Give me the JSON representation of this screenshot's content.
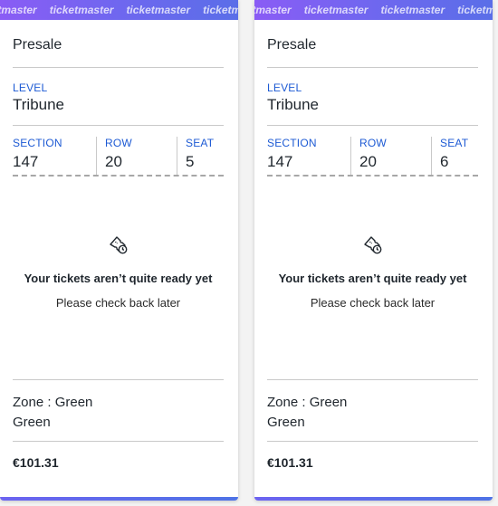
{
  "brand": "ticketmaster",
  "colors": {
    "accent": "#1d5ad4",
    "banner_start": "#8a5cf5",
    "banner_end": "#5a6ee8"
  },
  "labels": {
    "level": "LEVEL",
    "section": "SECTION",
    "row": "ROW",
    "seat": "SEAT"
  },
  "tickets": [
    {
      "type": "Presale",
      "level": "Tribune",
      "section": "147",
      "row": "20",
      "seat": "5",
      "status_icon": "ticket-clock-icon",
      "status_title": "Your tickets aren’t quite ready yet",
      "status_sub": "Please check back later",
      "zone_line1": "Zone : Green",
      "zone_line2": "Green",
      "price": "€101.31"
    },
    {
      "type": "Presale",
      "level": "Tribune",
      "section": "147",
      "row": "20",
      "seat": "6",
      "status_icon": "ticket-clock-icon",
      "status_title": "Your tickets aren’t quite ready yet",
      "status_sub": "Please check back later",
      "zone_line1": "Zone : Green",
      "zone_line2": "Green",
      "price": "€101.31"
    }
  ]
}
